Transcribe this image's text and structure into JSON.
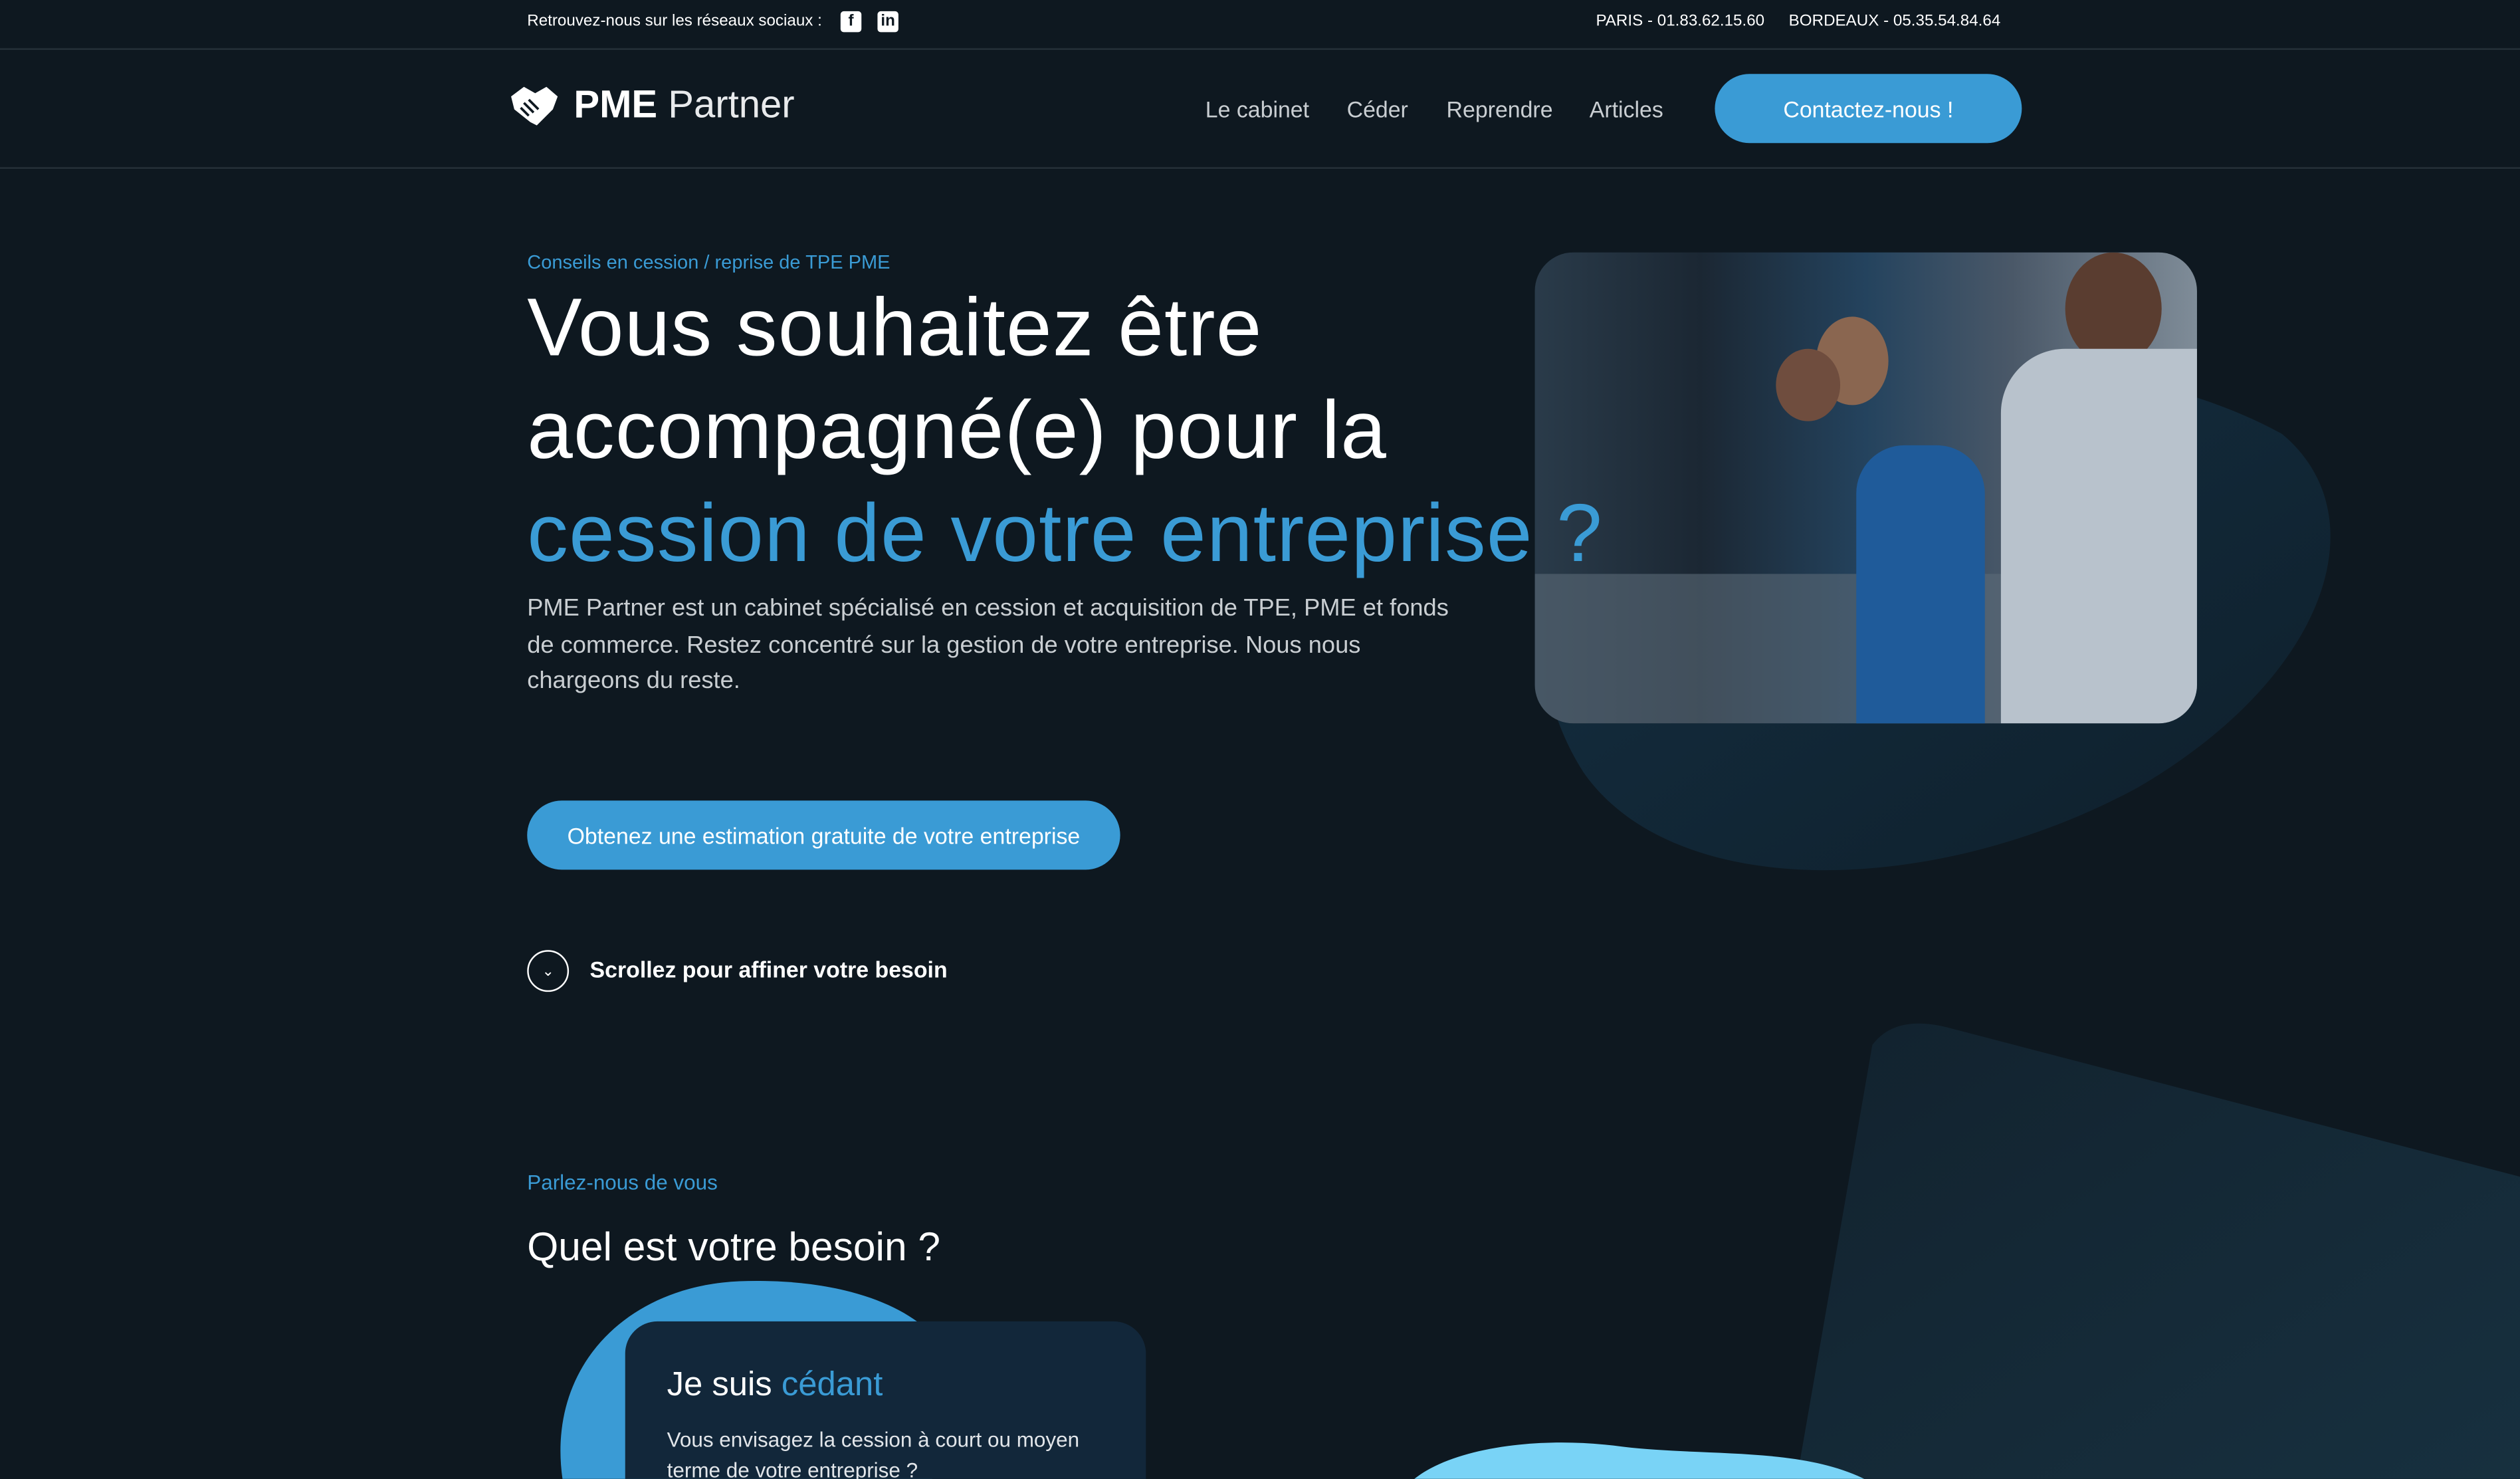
{
  "topbar": {
    "social_label": "Retrouvez-nous sur les réseaux sociaux :",
    "social_icons": [
      "facebook-icon",
      "linkedin-icon"
    ],
    "phone_paris": "PARIS - 01.83.62.15.60",
    "phone_bordeaux": "BORDEAUX - 05.35.54.84.64"
  },
  "header": {
    "logo_bold": "PME",
    "logo_light": "Partner",
    "nav": [
      "Le cabinet",
      "Céder",
      "Reprendre",
      "Articles"
    ],
    "cta": "Contactez-nous !"
  },
  "hero": {
    "eyebrow": "Conseils en cession / reprise de TPE PME",
    "title_line1": "Vous souhaitez être",
    "title_line2": "accompagné(e) pour la",
    "title_highlight": "cession de votre entreprise ?",
    "description": "PME Partner est un cabinet spécialisé en cession et acquisition de TPE, PME et fonds de commerce. Restez concentré sur la gestion de votre entreprise. Nous nous chargeons du reste.",
    "cta": "Obtenez une estimation gratuite de votre entreprise",
    "scroll_hint": "Scrollez pour affiner votre besoin"
  },
  "needs": {
    "eyebrow": "Parlez-nous de vous",
    "title": "Quel est votre besoin ?",
    "card": {
      "title_prefix": "Je suis",
      "title_highlight": "cédant",
      "text": "Vous envisagez la cession à court ou moyen terme de votre entreprise ?"
    }
  },
  "colors": {
    "background": "#0e1820",
    "accent": "#3a9bd5",
    "card": "#12273a"
  }
}
